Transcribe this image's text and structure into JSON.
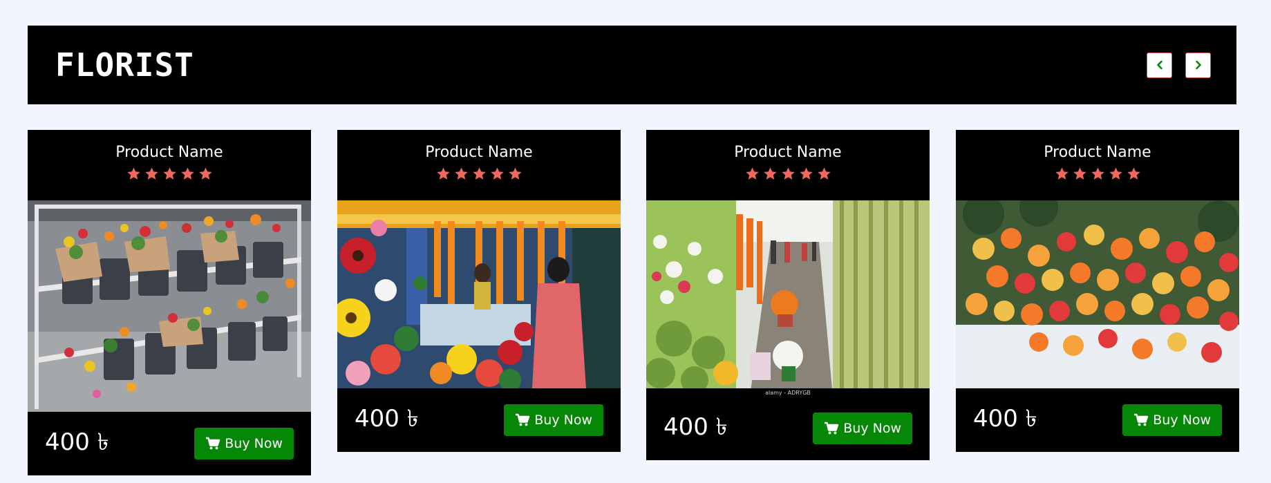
{
  "header": {
    "brand": "FLORIST",
    "prev_icon": "chevron-left-icon",
    "next_icon": "chevron-right-icon",
    "accent": "#078707"
  },
  "products": [
    {
      "name": "Product Name",
      "rating": 5,
      "price": "400 ৳",
      "button_label": "Buy Now",
      "image": "flower-cart-photo"
    },
    {
      "name": "Product Name",
      "rating": 5,
      "price": "400 ৳",
      "button_label": "Buy Now",
      "image": "flower-stall-photo"
    },
    {
      "name": "Product Name",
      "rating": 5,
      "price": "400 ৳",
      "button_label": "Buy Now",
      "image": "flower-market-photo",
      "image_caption": "alamy - ADRYGB"
    },
    {
      "name": "Product Name",
      "rating": 5,
      "price": "400 ৳",
      "button_label": "Buy Now",
      "image": "roses-pile-photo"
    }
  ],
  "colors": {
    "background": "#f2f5fd",
    "card": "#000000",
    "star": "#f1685e",
    "button": "#078707"
  }
}
